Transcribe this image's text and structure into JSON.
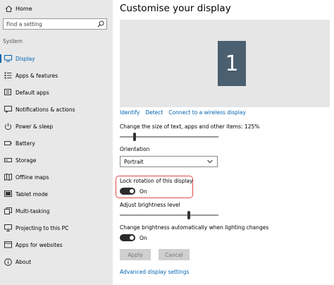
{
  "sidebar": {
    "home_label": "Home",
    "search_placeholder": "Find a setting",
    "section_label": "System",
    "items": [
      {
        "label": "Display",
        "icon": "monitor-icon",
        "active": true
      },
      {
        "label": "Apps & features",
        "icon": "apps-list-icon"
      },
      {
        "label": "Default apps",
        "icon": "default-apps-icon"
      },
      {
        "label": "Notifications & actions",
        "icon": "notifications-icon"
      },
      {
        "label": "Power & sleep",
        "icon": "power-icon"
      },
      {
        "label": "Battery",
        "icon": "battery-icon"
      },
      {
        "label": "Storage",
        "icon": "storage-icon"
      },
      {
        "label": "Offline maps",
        "icon": "map-icon"
      },
      {
        "label": "Tablet mode",
        "icon": "tablet-icon"
      },
      {
        "label": "Multi-tasking",
        "icon": "multitasking-icon"
      },
      {
        "label": "Projecting to this PC",
        "icon": "projecting-icon"
      },
      {
        "label": "Apps for websites",
        "icon": "apps-websites-icon"
      },
      {
        "label": "About",
        "icon": "info-icon"
      }
    ]
  },
  "main": {
    "title": "Customise your display",
    "monitor_number": "1",
    "links": [
      "Identify",
      "Detect",
      "Connect to a wireless display"
    ],
    "scale_label": "Change the size of text, apps and other items: 125%",
    "scale_level": 0.15,
    "orientation_label": "Orientation",
    "orientation_value": "Portrait",
    "lock_rotation_label": "Lock rotation of this display",
    "lock_rotation_state": "On",
    "brightness_label": "Adjust brightness level",
    "brightness_level": 0.7,
    "auto_brightness_label": "Change brightness automatically when lighting changes",
    "auto_brightness_state": "On",
    "apply_label": "Apply",
    "cancel_label": "Cancel",
    "advanced_link": "Advanced display settings"
  },
  "colors": {
    "accent": "#0063b1",
    "highlight": "#e0494a",
    "monitor": "#4a5f70"
  }
}
